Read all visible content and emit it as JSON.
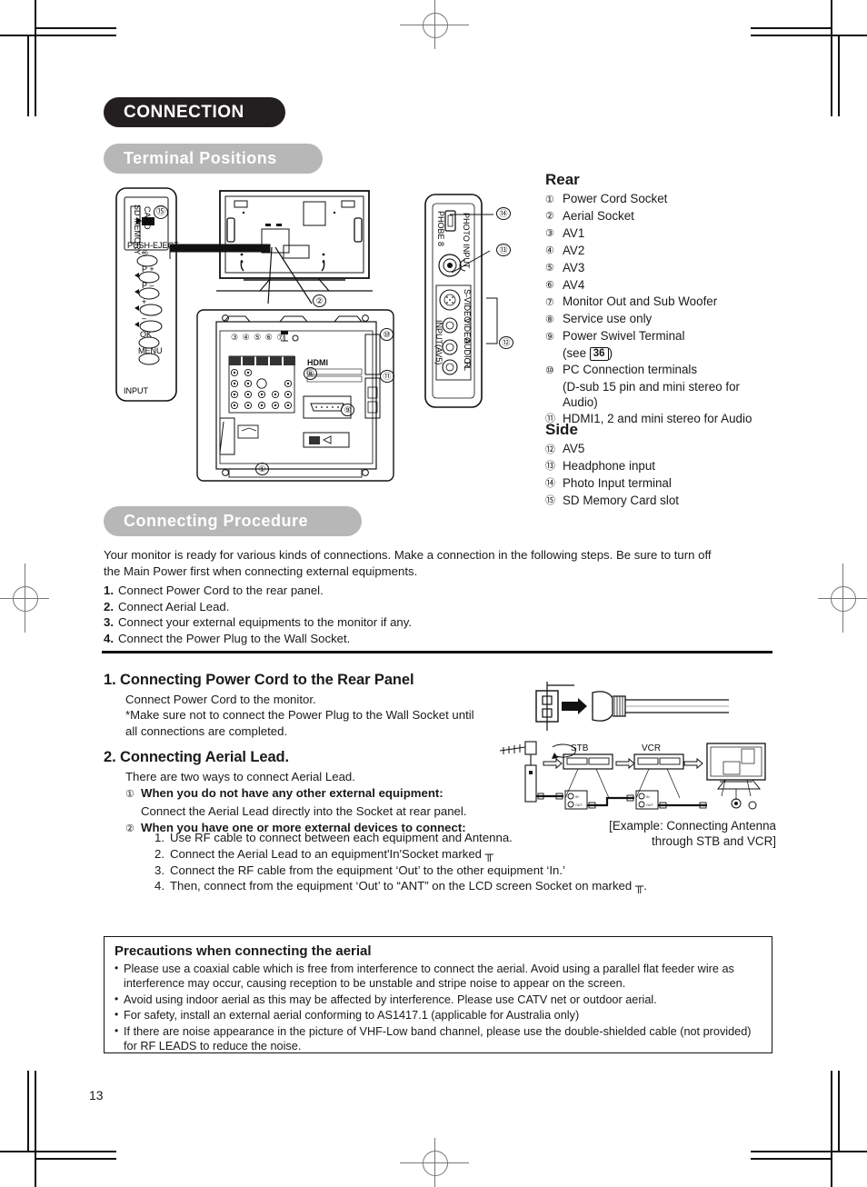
{
  "page": {
    "number": "13"
  },
  "headers": {
    "chapter": "CONNECTION",
    "terminal_positions": "Terminal Positions",
    "connecting_procedure": "Connecting Procedure"
  },
  "terminals": {
    "rear_heading": "Rear",
    "rear_items": [
      {
        "num": "①",
        "label": "Power Cord Socket"
      },
      {
        "num": "②",
        "label": "Aerial Socket"
      },
      {
        "num": "③",
        "label": "AV1"
      },
      {
        "num": "④",
        "label": "AV2"
      },
      {
        "num": "⑤",
        "label": "AV3"
      },
      {
        "num": "⑥",
        "label": "AV4"
      },
      {
        "num": "⑦",
        "label": "Monitor Out and Sub Woofer"
      },
      {
        "num": "⑧",
        "label": "Service use only"
      },
      {
        "num": "⑨",
        "label": "Power Swivel Terminal"
      },
      {
        "num": "⑩",
        "label": "PC Connection terminals"
      },
      {
        "num": "⑪",
        "label": "HDMI1, 2 and mini stereo for Audio"
      }
    ],
    "see_prefix": "(see ",
    "see_page": "36",
    "see_suffix": ")",
    "pc_line2": "(D-sub 15 pin and mini stereo for",
    "pc_line3": "Audio)",
    "side_heading": "Side",
    "side_items": [
      {
        "num": "⑫",
        "label": "AV5"
      },
      {
        "num": "⑬",
        "label": "Headphone input"
      },
      {
        "num": "⑭",
        "label": "Photo Input terminal"
      },
      {
        "num": "⑮",
        "label": "SD Memory Card slot"
      }
    ]
  },
  "procedure": {
    "intro_line1": "Your monitor is ready for various kinds of connections. Make a connection in the following steps. Be sure to turn off",
    "intro_line2": "the Main Power first when connecting external equipments.",
    "steps": [
      {
        "n": "1.",
        "text": "Connect Power Cord to the rear panel."
      },
      {
        "n": "2.",
        "text": "Connect Aerial Lead."
      },
      {
        "n": "3.",
        "text": "Connect your external equipments to the monitor if any."
      },
      {
        "n": "4.",
        "text": "Connect the Power Plug to the Wall Socket."
      }
    ]
  },
  "section1": {
    "heading": "1. Connecting Power Cord to the Rear Panel",
    "line1": "Connect Power Cord to the monitor.",
    "line2": "*Make sure not to connect the Power Plug to the Wall Socket until",
    "line3": " all connections are completed."
  },
  "section2": {
    "heading": "2. Connecting Aerial Lead.",
    "line1": "There are two ways to connect Aerial Lead.",
    "opt1_num": "①",
    "opt1_title": "When you do not have any other external equipment:",
    "opt1_body": "Connect the Aerial Lead directly into the Socket at rear panel.",
    "opt2_num": "②",
    "opt2_title": "When you have one or more external devices to connect:",
    "substeps": [
      {
        "n": "1.",
        "text": "Use RF cable to connect between each equipment and Antenna."
      },
      {
        "n": "2.",
        "text": "Connect the Aerial Lead to an equipment'In'Socket marked ╥"
      },
      {
        "n": "3.",
        "text": "Connect the RF cable from the equipment ‘Out’ to the other equipment ‘In.’"
      },
      {
        "n": "4.",
        "text": "Then, connect from the equipment ‘Out’ to “ANT” on the LCD screen Socket on marked ╥."
      }
    ]
  },
  "example": {
    "caption_line1": "[Example: Connecting Antenna",
    "caption_line2": "through STB and VCR]",
    "stb_label": "STB",
    "vcr_label": "VCR",
    "jack_in": "IN",
    "jack_out": "OUT"
  },
  "precautions": {
    "heading": "Precautions when connecting the aerial",
    "items": [
      "Please use a coaxial cable which is free from interference to connect the aerial. Avoid using a parallel flat feeder wire as interference may occur, causing reception to be unstable and stripe noise to appear on the screen.",
      "Avoid using indoor aerial as this may be affected by interference. Please use CATV net or outdoor aerial.",
      "For safety, install an external aerial conforming to AS1417.1 (applicable for Australia only)",
      "If there are noise appearance in the picture of VHF-Low band channel, please use the double-shielded cable (not provided) for RF LEADS to reduce the noise."
    ]
  },
  "diagram": {
    "side_panel": {
      "sd_label_1": "SD MEMORY",
      "sd_label_2": "CARD",
      "eject_label": "PUSH-EJECT",
      "callout": "⑮"
    },
    "side_jacks": {
      "photo_label": "PHOTO INPUT",
      "photo_callout": "⑭",
      "headphone_callout": "⑬",
      "av5_callout": "⑫",
      "input_label": "INPUT(AV5)",
      "jack_svideo": "S-VIDEO",
      "jack_video": "VIDEO",
      "jack_audio_l": "AUDIO L",
      "jack_audio_r": "R"
    },
    "rear_panel": {
      "hdmi_label": "HDMI",
      "aerial_callout": "②",
      "power_callout": "①",
      "service_callout": "⑧",
      "swivel_callout": "⑨",
      "pc_callout": "⑩",
      "hdmi_callout": "⑪",
      "input_callouts": [
        "③",
        "④",
        "⑤",
        "⑥",
        "⑦"
      ]
    }
  },
  "colors": {
    "banner_dark": "#231f20",
    "banner_grey": "#b7b7b7",
    "ink": "#1a1a1a",
    "reg_mark": "#777777"
  }
}
